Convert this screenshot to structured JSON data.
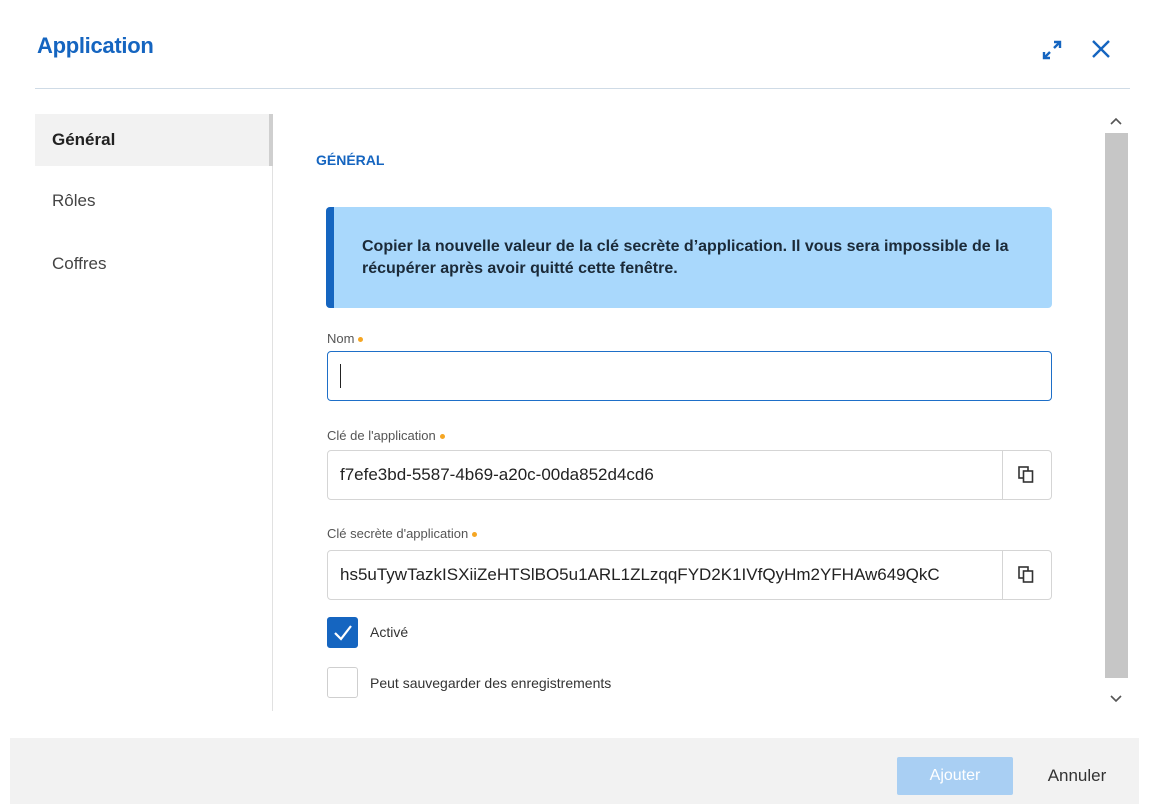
{
  "dialog": {
    "title": "Application"
  },
  "icons": {
    "expand": "expand-icon",
    "close": "close-icon",
    "copy": "copy-icon",
    "check": "check-icon",
    "scroll_up": "chevron-up-icon",
    "scroll_down": "chevron-down-icon"
  },
  "sidebar": {
    "items": [
      {
        "label": "Général",
        "active": true
      },
      {
        "label": "Rôles",
        "active": false
      },
      {
        "label": "Coffres",
        "active": false
      }
    ]
  },
  "section": {
    "title": "GÉNÉRAL"
  },
  "info": {
    "message": "Copier la nouvelle valeur de la clé secrète d’application. Il vous sera impossible de la récupérer après avoir quitté cette fenêtre."
  },
  "fields": {
    "name": {
      "label": "Nom",
      "value": "",
      "required": true
    },
    "app_key": {
      "label": "Clé de l'application",
      "value": "f7efe3bd-5587-4b69-a20c-00da852d4cd6",
      "required": true
    },
    "secret_key": {
      "label": "Clé secrète d'application",
      "value": "hs5uTywTazkISXiiZeHTSlBO5u1ARL1ZLzqqFYD2K1IVfQyHm2YFHAw649QkC",
      "required": true
    }
  },
  "options": {
    "enabled": {
      "label": "Activé",
      "checked": true
    },
    "can_save": {
      "label": "Peut sauvegarder des enregistrements",
      "checked": false
    }
  },
  "footer": {
    "add_label": "Ajouter",
    "cancel_label": "Annuler"
  },
  "colors": {
    "accent": "#1565c0",
    "info_bg": "#a9d8fc",
    "required_dot": "#f5a623",
    "add_disabled": "#a9cff3"
  }
}
